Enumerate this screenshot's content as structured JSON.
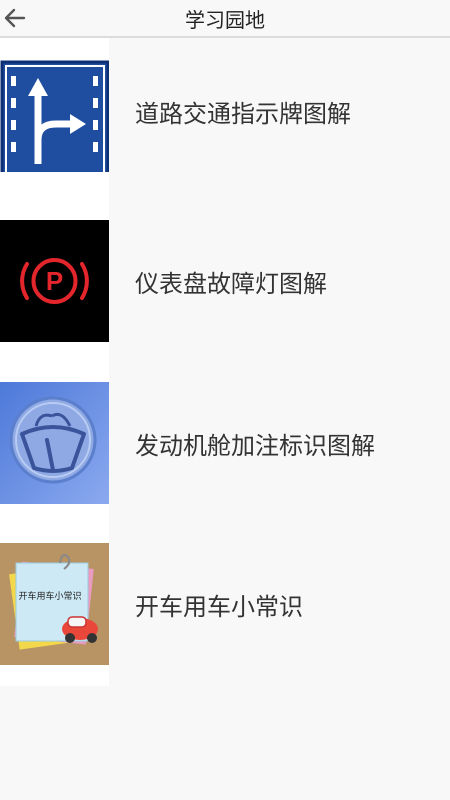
{
  "header": {
    "title": "学习园地",
    "back_icon": "arrow-left-icon"
  },
  "items": [
    {
      "label": "道路交通指示牌图解",
      "icon": "traffic-sign-icon"
    },
    {
      "label": "仪表盘故障灯图解",
      "icon": "parking-brake-warning-icon"
    },
    {
      "label": "发动机舱加注标识图解",
      "icon": "windshield-washer-icon"
    },
    {
      "label": "开车用车小常识",
      "icon": "car-notes-icon",
      "note_text": "开车用车小常识"
    }
  ]
}
